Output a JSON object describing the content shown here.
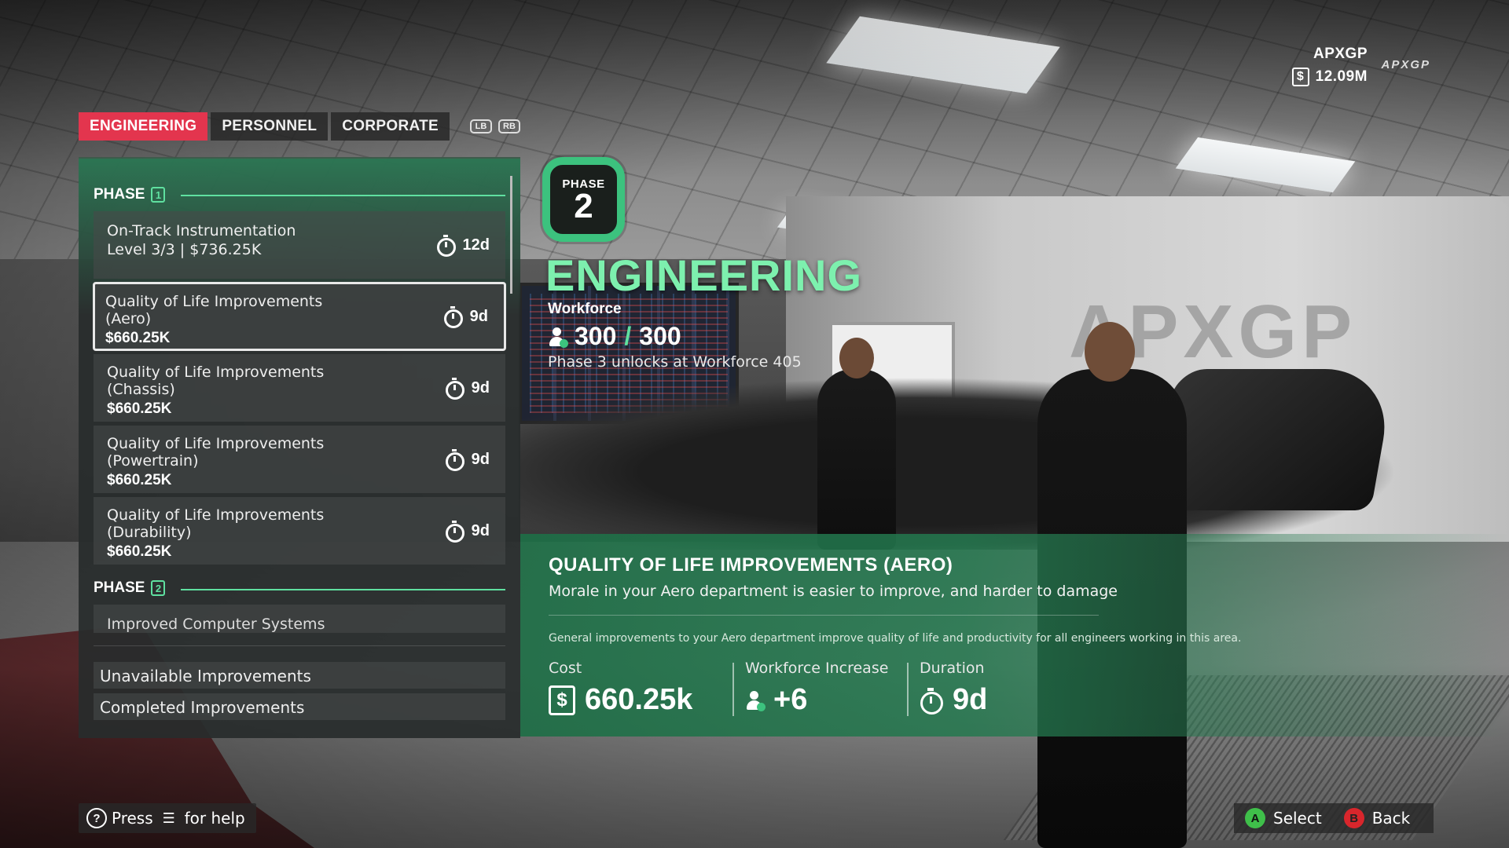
{
  "team": {
    "name": "APXGP",
    "funds": "12.09M",
    "currency_symbol": "$",
    "logo_text": "APXGP"
  },
  "tabs": [
    {
      "label": "ENGINEERING",
      "active": true
    },
    {
      "label": "PERSONNEL",
      "active": false
    },
    {
      "label": "CORPORATE",
      "active": false
    }
  ],
  "shoulder_buttons": {
    "left": "LB",
    "right": "RB"
  },
  "list": {
    "phase1": {
      "label": "PHASE",
      "number": "1"
    },
    "items": [
      {
        "title": "On-Track Instrumentation",
        "sub": "Level 3/3 | $736.25K",
        "price": "",
        "duration": "12d"
      },
      {
        "title": "Quality of Life Improvements\n(Aero)",
        "price": "$660.25K",
        "duration": "9d",
        "selected": true
      },
      {
        "title": "Quality of Life Improvements\n(Chassis)",
        "price": "$660.25K",
        "duration": "9d"
      },
      {
        "title": "Quality of Life Improvements\n(Powertrain)",
        "price": "$660.25K",
        "duration": "9d"
      },
      {
        "title": "Quality of Life Improvements\n(Durability)",
        "price": "$660.25K",
        "duration": "9d"
      }
    ],
    "phase2": {
      "label": "PHASE",
      "number": "2"
    },
    "cut_item": "Improved Computer Systems",
    "footer": {
      "unavailable": "Unavailable Improvements",
      "completed": "Completed Improvements"
    }
  },
  "department": {
    "phase_label": "PHASE",
    "phase_number": "2",
    "title": "ENGINEERING",
    "workforce_label": "Workforce",
    "workforce_current": "300",
    "workforce_sep": "/",
    "workforce_max": "300",
    "unlock_text": "Phase 3 unlocks at Workforce 405"
  },
  "detail": {
    "title": "QUALITY OF LIFE IMPROVEMENTS (AERO)",
    "description": "Morale in your Aero department is easier to improve, and harder to damage",
    "note": "General improvements to your Aero department improve quality of life and productivity for all engineers working in this area.",
    "cost_label": "Cost",
    "cost_value": "660.25k",
    "workforce_label": "Workforce Increase",
    "workforce_value": "+6",
    "duration_label": "Duration",
    "duration_value": "9d"
  },
  "prompts": {
    "help_press": "Press",
    "help_suffix": "for help",
    "select_glyph": "A",
    "select": "Select",
    "back_glyph": "B",
    "back": "Back"
  },
  "icons": [
    "dollar-icon",
    "stopwatch-icon",
    "workforce-icon",
    "help-icon",
    "menu-button-icon",
    "a-button-icon",
    "b-button-icon"
  ],
  "colors": {
    "accent_red": "#e3354e",
    "accent_green": "#7df0ae",
    "phase_green": "#3cc27e"
  }
}
